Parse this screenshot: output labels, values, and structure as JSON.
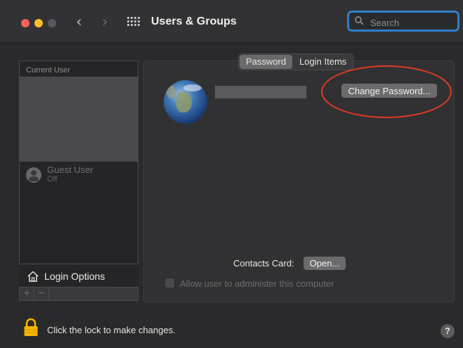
{
  "window": {
    "title": "Users & Groups",
    "nav_back_glyph": "‹",
    "nav_forward_glyph": "›",
    "grid_icon": "grid-icon"
  },
  "search": {
    "placeholder": "Search",
    "value": ""
  },
  "user_list": {
    "section_header": "Current User",
    "guest_user": {
      "name": "Guest User",
      "status": "Off"
    },
    "login_options_label": "Login Options",
    "add_glyph": "+",
    "remove_glyph": "−"
  },
  "tabs": [
    {
      "label": "Password",
      "active": true
    },
    {
      "label": "Login Items",
      "active": false
    }
  ],
  "panel": {
    "change_password_label": "Change Password...",
    "contacts_card_label": "Contacts Card:",
    "open_button_label": "Open...",
    "admin_checkbox_label": "Allow user to administer this computer",
    "admin_checkbox_checked": false
  },
  "footer": {
    "lock_text": "Click the lock to make changes.",
    "help_glyph": "?"
  },
  "colors": {
    "highlight_ring": "#e23b22",
    "search_focus": "#2f7fc9",
    "lock": "#f5b400"
  }
}
